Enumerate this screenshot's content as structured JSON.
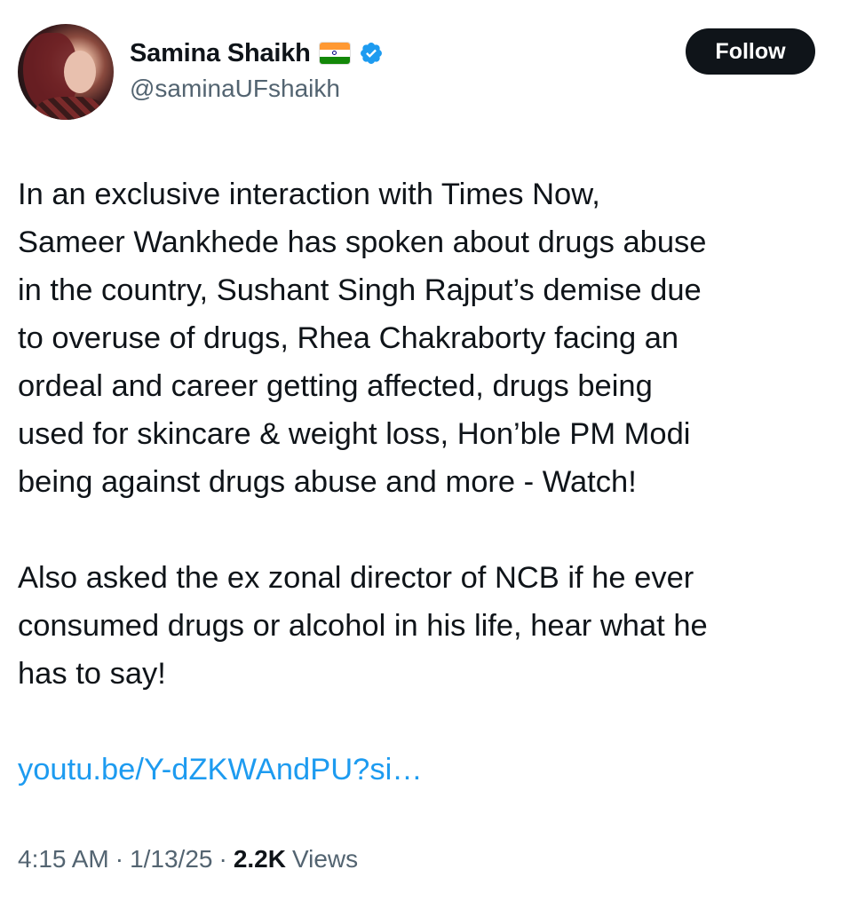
{
  "user": {
    "display_name": "Samina Shaikh",
    "handle": "@saminaUFshaikh",
    "flag": "india-flag",
    "verified": "verified-badge-icon"
  },
  "follow_label": "Follow",
  "tweet": {
    "lines_para1": [
      "In an exclusive interaction with Times Now,",
      "Sameer Wankhede has spoken about drugs abuse",
      "in the country, Sushant Singh Rajput’s demise due",
      "to overuse of drugs, Rhea Chakraborty facing an",
      "ordeal and career getting affected, drugs being",
      "used for skincare & weight loss, Hon’ble PM Modi",
      "being against drugs abuse and more - Watch!"
    ],
    "lines_para2": [
      "Also asked the ex zonal director of NCB if he ever",
      "consumed drugs or alcohol in his life, hear what he",
      "has to say!"
    ],
    "link": "youtu.be/Y-dZKWAndPU?si…"
  },
  "meta": {
    "time": "4:15 AM",
    "date": "1/13/25",
    "views_count": "2.2K",
    "views_label": "Views",
    "separator": "·"
  },
  "colors": {
    "text": "#0f1419",
    "secondary": "#536471",
    "link": "#1d9bf0",
    "verified": "#1d9bf0",
    "button_bg": "#0f1419"
  }
}
